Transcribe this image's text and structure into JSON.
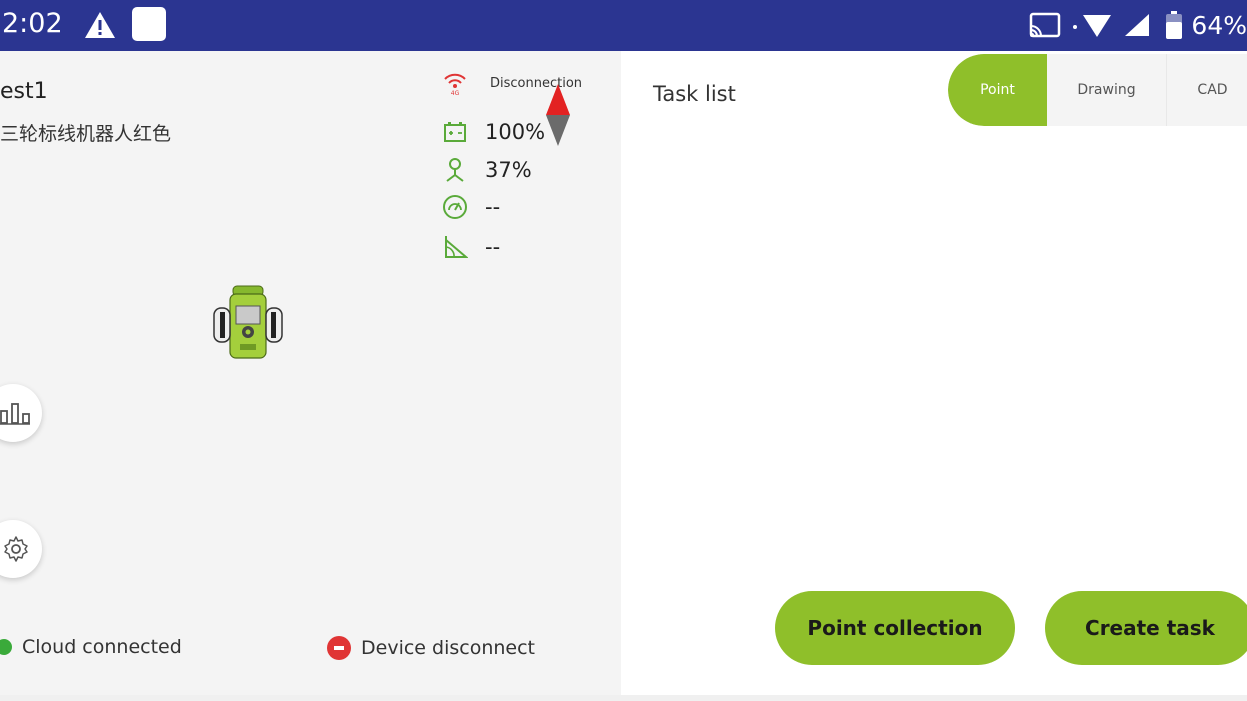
{
  "status_bar": {
    "time": "2:02",
    "battery_pct": "64%",
    "icons": [
      "alert-icon",
      "app-icon",
      "cast-icon",
      "wifi-icon",
      "signal-icon",
      "battery-icon"
    ]
  },
  "device": {
    "name": "est1",
    "description": "三轮标线机器人红色",
    "connection_label": "Disconnection",
    "battery": "100%",
    "satellite": "37%",
    "speed": "--",
    "angle": "--"
  },
  "footer": {
    "cloud_status": "Cloud connected",
    "device_status": "Device disconnect"
  },
  "task_panel": {
    "title": "Task list",
    "tabs": [
      {
        "label": "Point",
        "active": true
      },
      {
        "label": "Drawing",
        "active": false
      },
      {
        "label": "CAD",
        "active": false
      }
    ],
    "point_collection_label": "Point collection",
    "create_task_label": "Create task"
  },
  "colors": {
    "accent": "#8fbf2a",
    "status_bar": "#2b3591",
    "error": "#e03535",
    "success": "#3aaa3a"
  }
}
